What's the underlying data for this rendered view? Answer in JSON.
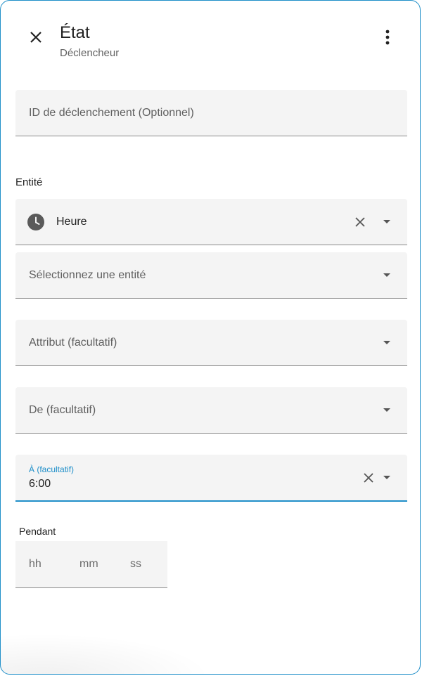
{
  "header": {
    "title": "État",
    "subtitle": "Déclencheur"
  },
  "trigger_id_field": {
    "placeholder": "ID de déclenchement (Optionnel)"
  },
  "entity_section": {
    "label": "Entité",
    "selected_entity": {
      "name": "Heure",
      "icon": "clock-icon"
    },
    "select_placeholder": "Sélectionnez une entité"
  },
  "attribute_field": {
    "placeholder": "Attribut (facultatif)"
  },
  "from_field": {
    "placeholder": "De (facultatif)"
  },
  "to_field": {
    "label": "À (facultatif)",
    "value": "6:00"
  },
  "duration": {
    "label": "Pendant",
    "hours_placeholder": "hh",
    "minutes_placeholder": "mm",
    "seconds_placeholder": "ss"
  },
  "colors": {
    "accent": "#1f8fc9",
    "field_bg": "#f4f4f4"
  }
}
